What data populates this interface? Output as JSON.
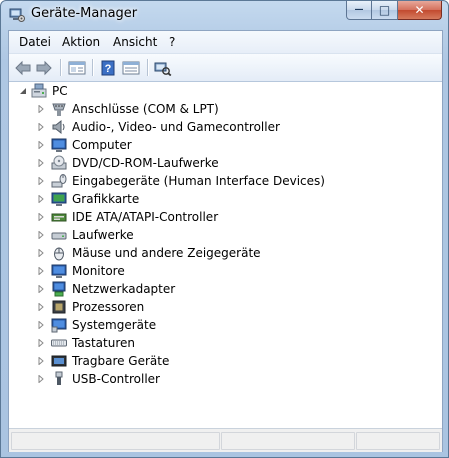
{
  "window": {
    "title": "Geräte-Manager",
    "icon": "device-manager-icon",
    "minimize": "—",
    "maximize": "□",
    "close": "✕"
  },
  "menu": [
    "Datei",
    "Aktion",
    "Ansicht",
    "?"
  ],
  "toolbar": {
    "buttons": [
      "back-icon",
      "forward-icon",
      "properties-pane-icon",
      "help-icon",
      "show-hide-console-tree-icon",
      "scan-hardware-icon"
    ]
  },
  "tree": {
    "root": {
      "label": "PC",
      "icon": "computer-icon"
    },
    "items": [
      {
        "label": "Anschlüsse (COM & LPT)",
        "icon": "port-icon"
      },
      {
        "label": "Audio-, Video- und Gamecontroller",
        "icon": "speaker-icon"
      },
      {
        "label": "Computer",
        "icon": "monitor-icon"
      },
      {
        "label": "DVD/CD-ROM-Laufwerke",
        "icon": "dvd-drive-icon"
      },
      {
        "label": "Eingabegeräte (Human Interface Devices)",
        "icon": "hid-icon"
      },
      {
        "label": "Grafikkarte",
        "icon": "display-adapter-icon"
      },
      {
        "label": "IDE ATA/ATAPI-Controller",
        "icon": "ide-controller-icon"
      },
      {
        "label": "Laufwerke",
        "icon": "disk-drive-icon"
      },
      {
        "label": "Mäuse und andere Zeigegeräte",
        "icon": "mouse-icon"
      },
      {
        "label": "Monitore",
        "icon": "monitor-icon"
      },
      {
        "label": "Netzwerkadapter",
        "icon": "network-adapter-icon"
      },
      {
        "label": "Prozessoren",
        "icon": "processor-icon"
      },
      {
        "label": "Systemgeräte",
        "icon": "system-device-icon"
      },
      {
        "label": "Tastaturen",
        "icon": "keyboard-icon"
      },
      {
        "label": "Tragbare Geräte",
        "icon": "portable-device-icon"
      },
      {
        "label": "USB-Controller",
        "icon": "usb-icon"
      }
    ]
  }
}
